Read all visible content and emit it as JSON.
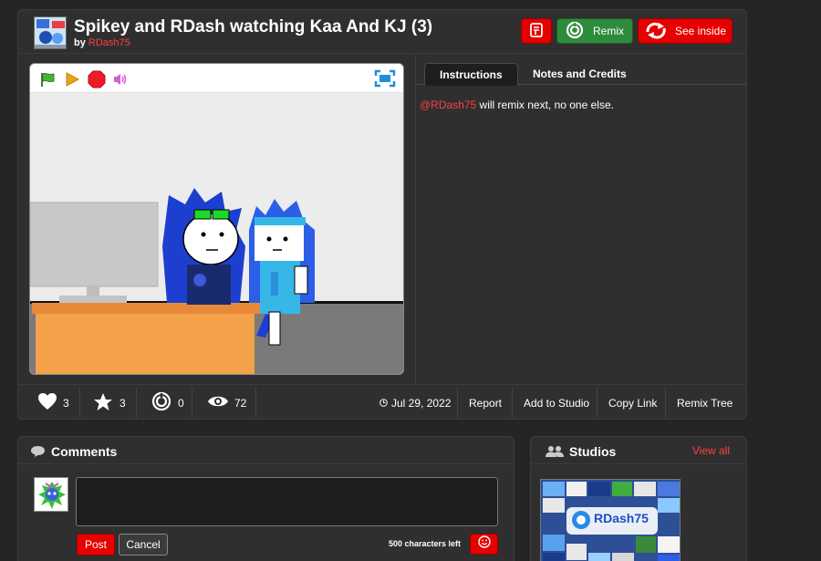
{
  "project": {
    "title": "Spikey and RDash watching Kaa And KJ (3)",
    "by_label": "by",
    "author": "RDash75"
  },
  "header_buttons": {
    "remix_label": "Remix",
    "see_inside_label": "See inside"
  },
  "tabs": [
    {
      "label": "Instructions",
      "active": true
    },
    {
      "label": "Notes and Credits",
      "active": false
    }
  ],
  "instructions": {
    "mention": "@RDash75",
    "text": " will remix next, no one else."
  },
  "stats": {
    "loves": "3",
    "favorites": "3",
    "remixes": "0",
    "views": "72"
  },
  "actions": {
    "date": "Jul 29, 2022",
    "report": "Report",
    "add_to_studio": "Add to Studio",
    "copy_link": "Copy Link",
    "remix_tree": "Remix Tree"
  },
  "comments": {
    "title": "Comments",
    "post_label": "Post",
    "cancel_label": "Cancel",
    "chars_left": "500 characters left"
  },
  "studios": {
    "title": "Studios",
    "view_all": "View all",
    "thumb_text": "RDash75"
  },
  "colors": {
    "accent_red": "#e60000",
    "remix_green": "#2e8b3c",
    "link_red": "#ff3f3f"
  }
}
